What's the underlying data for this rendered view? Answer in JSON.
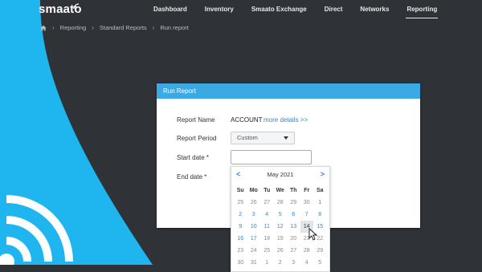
{
  "brand": {
    "name": "smaato"
  },
  "nav": {
    "items": [
      {
        "label": "Dashboard",
        "active": false
      },
      {
        "label": "Inventory",
        "active": false
      },
      {
        "label": "Smaato Exchange",
        "active": false
      },
      {
        "label": "Direct",
        "active": false
      },
      {
        "label": "Networks",
        "active": false
      },
      {
        "label": "Reporting",
        "active": true
      }
    ]
  },
  "breadcrumb": [
    "Reporting",
    "Standard Reports",
    "Run report"
  ],
  "modal": {
    "title": "Run Report",
    "report_name_label": "Report Name",
    "report_name_value": "ACCOUNT",
    "more_details": "more details >>",
    "report_period_label": "Report Period",
    "report_period_value": "Custom",
    "start_date_label": "Start date *",
    "start_date_value": "",
    "end_date_label": "End date *"
  },
  "calendar": {
    "month": "May 2021",
    "prev": "<",
    "next": ">",
    "days_of_week": [
      "Su",
      "Mo",
      "Tu",
      "We",
      "Th",
      "Fr",
      "Sa"
    ],
    "weeks": [
      [
        {
          "d": "25",
          "cur": false
        },
        {
          "d": "26",
          "cur": false
        },
        {
          "d": "27",
          "cur": false
        },
        {
          "d": "28",
          "cur": false
        },
        {
          "d": "29",
          "cur": false
        },
        {
          "d": "30",
          "cur": false
        },
        {
          "d": "1",
          "cur": true
        }
      ],
      [
        {
          "d": "2",
          "cur": true
        },
        {
          "d": "3",
          "cur": true
        },
        {
          "d": "4",
          "cur": true
        },
        {
          "d": "5",
          "cur": true
        },
        {
          "d": "6",
          "cur": true
        },
        {
          "d": "7",
          "cur": true
        },
        {
          "d": "8",
          "cur": true
        }
      ],
      [
        {
          "d": "9",
          "cur": true
        },
        {
          "d": "10",
          "cur": true
        },
        {
          "d": "11",
          "cur": true
        },
        {
          "d": "12",
          "cur": true
        },
        {
          "d": "13",
          "cur": true
        },
        {
          "d": "14",
          "cur": true,
          "today": true
        },
        {
          "d": "15",
          "cur": true
        }
      ],
      [
        {
          "d": "16",
          "cur": true
        },
        {
          "d": "17",
          "cur": true
        },
        {
          "d": "18",
          "cur": false
        },
        {
          "d": "19",
          "cur": false
        },
        {
          "d": "20",
          "cur": false
        },
        {
          "d": "21",
          "cur": false
        },
        {
          "d": "22",
          "cur": false
        }
      ],
      [
        {
          "d": "23",
          "cur": false
        },
        {
          "d": "24",
          "cur": false
        },
        {
          "d": "25",
          "cur": false
        },
        {
          "d": "26",
          "cur": false
        },
        {
          "d": "27",
          "cur": false
        },
        {
          "d": "28",
          "cur": false
        },
        {
          "d": "29",
          "cur": false
        }
      ],
      [
        {
          "d": "30",
          "cur": false
        },
        {
          "d": "31",
          "cur": false
        },
        {
          "d": "1",
          "cur": false
        },
        {
          "d": "2",
          "cur": false
        },
        {
          "d": "3",
          "cur": false
        },
        {
          "d": "4",
          "cur": false
        },
        {
          "d": "5",
          "cur": false
        }
      ]
    ]
  },
  "colors": {
    "accent": "#3aa9e4",
    "link": "#3a83c9",
    "background": "#2f3236",
    "brand_blue": "#1fb6ef"
  },
  "icons": {
    "home": "home-icon",
    "caret": "chevron-down-icon",
    "cursor": "mouse-cursor-icon",
    "signal": "wifi-signal-icon"
  }
}
